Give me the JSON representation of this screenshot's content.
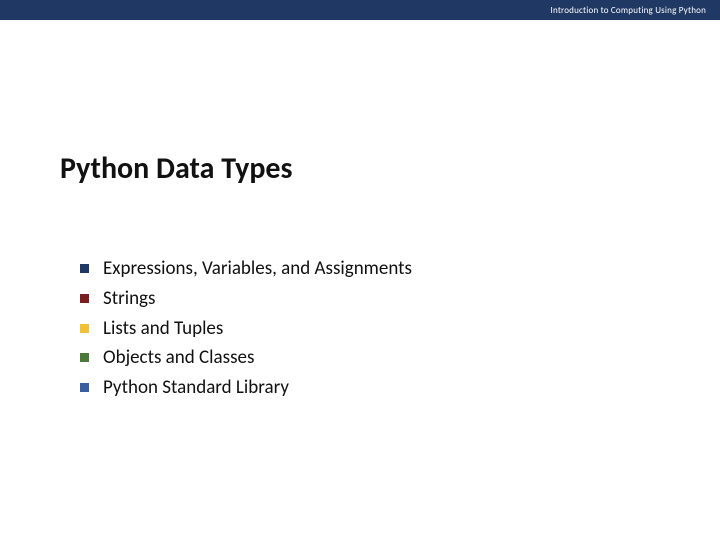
{
  "header": {
    "course_label": "Introduction to Computing Using Python"
  },
  "slide": {
    "title": "Python Data Types",
    "bullets": [
      {
        "label": "Expressions, Variables, and Assignments"
      },
      {
        "label": "Strings"
      },
      {
        "label": "Lists and Tuples"
      },
      {
        "label": "Objects and Classes"
      },
      {
        "label": "Python Standard Library"
      }
    ],
    "bullet_colors": [
      "#203864",
      "#7a1f1f",
      "#f1c233",
      "#4a7a3a",
      "#3a5fa0"
    ]
  }
}
